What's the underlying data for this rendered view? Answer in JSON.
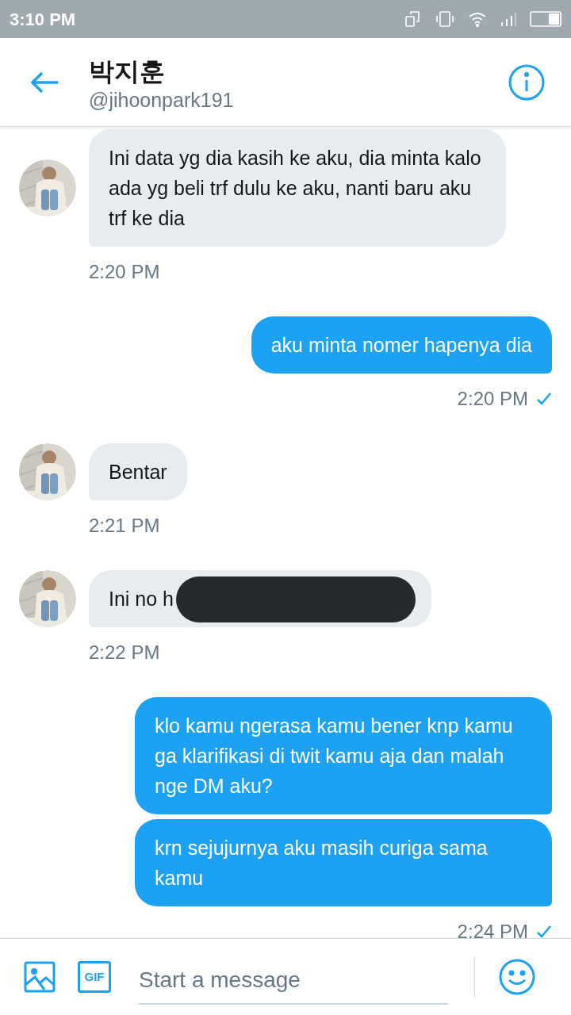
{
  "status_bar": {
    "time": "3:10 PM"
  },
  "header": {
    "name": "박지훈",
    "handle": "@jihoonpark191"
  },
  "messages": [
    {
      "kind": "received",
      "bubbles": [
        {
          "text": "Ini data yg dia kasih ke aku, dia minta kalo ada yg beli trf dulu ke aku, nanti baru aku trf ke dia",
          "redacted": false
        }
      ],
      "time": "2:20 PM"
    },
    {
      "kind": "sent",
      "bubbles": [
        {
          "text": "aku minta nomer hapenya dia",
          "redacted": false
        }
      ],
      "time": "2:20 PM",
      "delivered": true
    },
    {
      "kind": "received",
      "bubbles": [
        {
          "text": "Bentar",
          "redacted": false
        }
      ],
      "time": "2:21 PM"
    },
    {
      "kind": "received",
      "bubbles": [
        {
          "text": "Ini no h",
          "redacted": true
        }
      ],
      "time": "2:22 PM"
    },
    {
      "kind": "sent",
      "bubbles": [
        {
          "text": "klo kamu ngerasa kamu bener knp kamu ga klarifikasi di twit kamu aja dan malah nge DM aku?",
          "redacted": false
        },
        {
          "text": "krn sejujurnya aku masih curiga sama kamu",
          "redacted": false
        }
      ],
      "time": "2:24 PM",
      "delivered": true
    }
  ],
  "composer": {
    "gif_label": "GIF",
    "placeholder": "Start a message"
  }
}
